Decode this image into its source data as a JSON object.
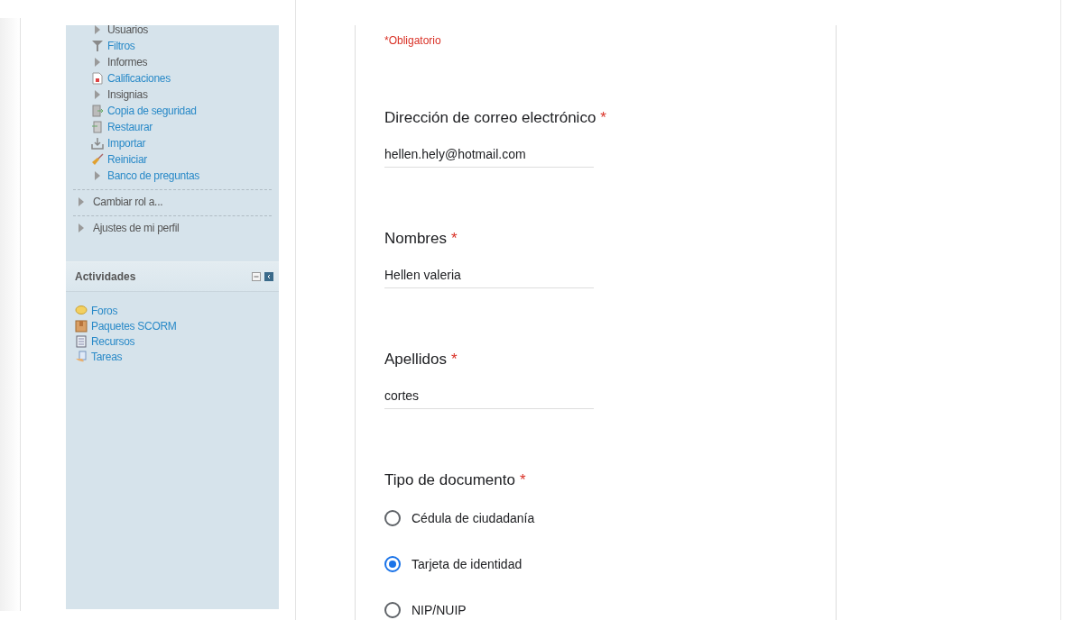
{
  "sidebar": {
    "nav_items": [
      {
        "kind": "node",
        "label": "Usuarios"
      },
      {
        "kind": "filter",
        "label": "Filtros"
      },
      {
        "kind": "node",
        "label": "Informes"
      },
      {
        "kind": "grades",
        "label": "Calificaciones"
      },
      {
        "kind": "node",
        "label": "Insignias"
      },
      {
        "kind": "backup",
        "label": "Copia de seguridad"
      },
      {
        "kind": "restore",
        "label": "Restaurar"
      },
      {
        "kind": "import",
        "label": "Importar"
      },
      {
        "kind": "reset",
        "label": "Reiniciar"
      },
      {
        "kind": "branch",
        "label": "Banco de preguntas"
      }
    ],
    "sections": [
      "Cambiar rol a...",
      "Ajustes de mi perfil"
    ],
    "activities_block": {
      "title": "Actividades",
      "items": [
        {
          "kind": "forum",
          "label": "Foros"
        },
        {
          "kind": "scorm",
          "label": "Paquetes SCORM"
        },
        {
          "kind": "resource",
          "label": "Recursos"
        },
        {
          "kind": "assign",
          "label": "Tareas"
        }
      ]
    }
  },
  "form": {
    "required_note": "*Obligatorio",
    "questions": [
      {
        "kind": "text",
        "label": "Dirección de correo electrónico",
        "required_mark": "*",
        "value": "hellen.hely@hotmail.com"
      },
      {
        "kind": "text",
        "label": "Nombres",
        "required_mark": "*",
        "value": "Hellen valeria"
      },
      {
        "kind": "text",
        "label": "Apellidos",
        "required_mark": "*",
        "value": "cortes"
      },
      {
        "kind": "radio",
        "label": "Tipo de documento",
        "required_mark": "*",
        "options": [
          {
            "label": "Cédula de ciudadanía",
            "selected": false
          },
          {
            "label": "Tarjeta de identidad",
            "selected": true
          },
          {
            "label": "NIP/NUIP",
            "selected": false
          }
        ]
      }
    ]
  }
}
